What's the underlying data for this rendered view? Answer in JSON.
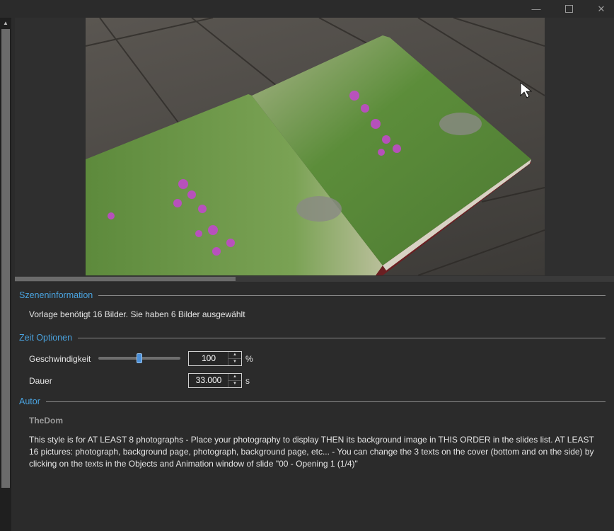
{
  "window": {
    "minimize_icon": "minimize-icon",
    "maximize_icon": "maximize-icon",
    "close_icon": "close-icon",
    "close_glyph": "✕",
    "min_glyph": "—"
  },
  "preview": {
    "image_description_icon": "photo-book-preview",
    "scrollbar": {
      "position_fraction": 0.0
    }
  },
  "sections": {
    "scene_info": {
      "title": "Szeneninformation",
      "text": "Vorlage benötigt 16 Bilder. Sie haben 6 Bilder ausgewählt"
    },
    "time_options": {
      "title": "Zeit Optionen",
      "speed": {
        "label": "Geschwindigkeit",
        "value": "100",
        "unit": "%",
        "slider_fraction": 0.5
      },
      "duration": {
        "label": "Dauer",
        "value": "33.000",
        "unit": "s"
      }
    },
    "author": {
      "title": "Autor",
      "name": "TheDom",
      "description": "This style is for AT LEAST 8 photographs - Place your photography to display THEN its background image in THIS ORDER in the slides list. AT LEAST 16 pictures: photograph, background page, photograph, background page, etc... - You can change the 3 texts on the cover (bottom and on the side) by clicking on the texts in the Objects and Animation window of slide \"00 - Opening 1 (1/4)\""
    }
  },
  "colors": {
    "accent": "#4aa3df",
    "background": "#2b2b2b",
    "text": "#e6e6e6"
  }
}
